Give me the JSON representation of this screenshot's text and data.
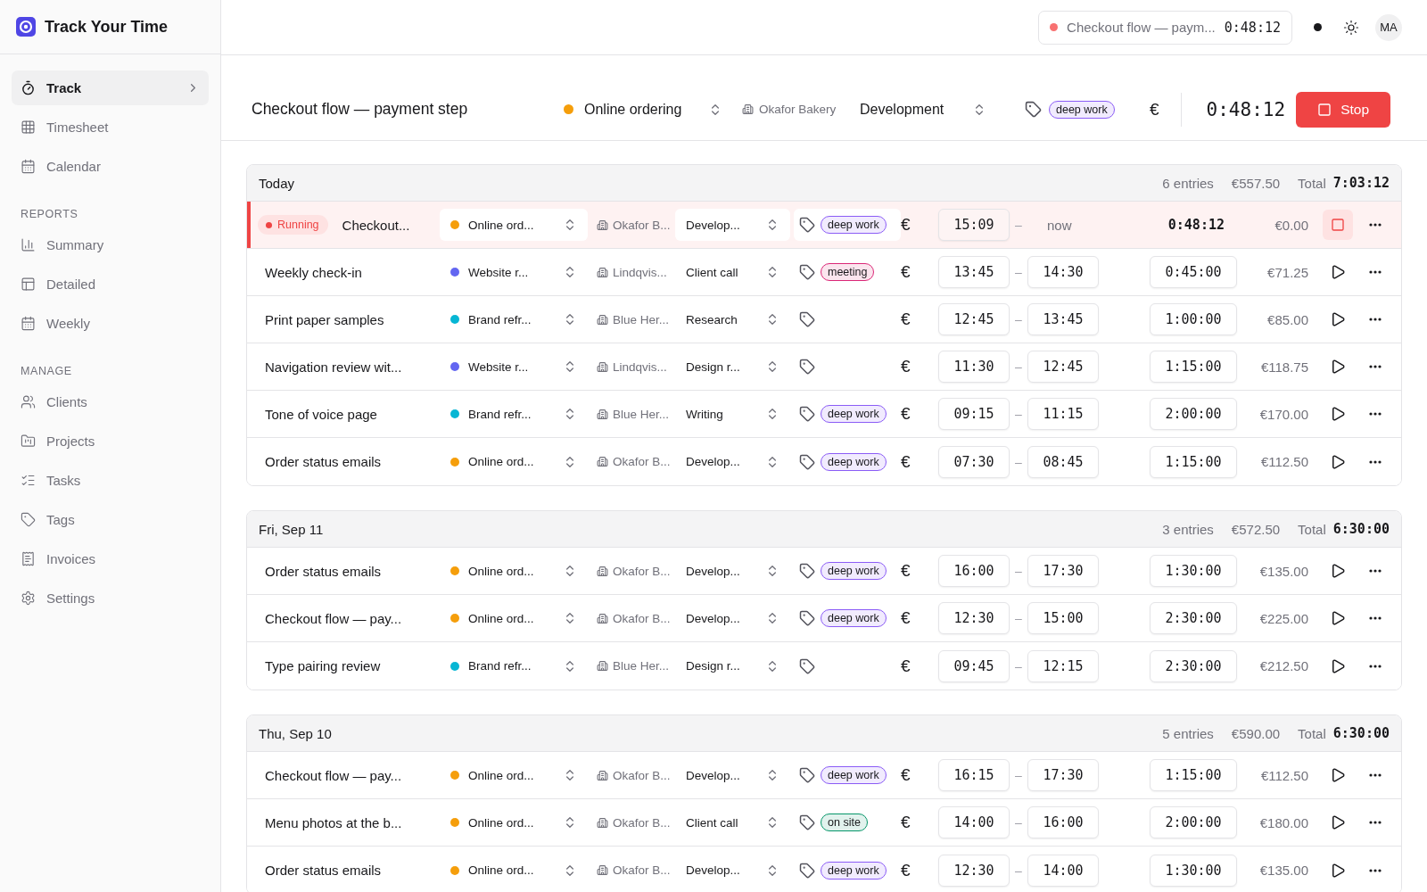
{
  "app": {
    "title": "Track Your Time"
  },
  "sidebar": {
    "sections": [
      {
        "items": [
          {
            "label": "Track",
            "selected": true
          },
          {
            "label": "Timesheet",
            "selected": false
          },
          {
            "label": "Calendar",
            "selected": false
          }
        ]
      },
      {
        "heading": "REPORTS",
        "items": [
          {
            "label": "Summary",
            "selected": false
          },
          {
            "label": "Detailed",
            "selected": false
          },
          {
            "label": "Weekly",
            "selected": false
          }
        ]
      },
      {
        "heading": "MANAGE",
        "items": [
          {
            "label": "Clients",
            "selected": false
          },
          {
            "label": "Projects",
            "selected": false
          },
          {
            "label": "Tasks",
            "selected": false
          },
          {
            "label": "Tags",
            "selected": false
          },
          {
            "label": "Invoices",
            "selected": false
          },
          {
            "label": "Settings",
            "selected": false
          }
        ]
      }
    ]
  },
  "topbar": {
    "current": {
      "description": "Checkout flow — paym...",
      "time": "0:48:12",
      "color": "#f87171"
    },
    "avatar": "MA"
  },
  "timer": {
    "description": "Checkout flow — payment step",
    "project": {
      "name": "Online ordering",
      "color": "#f59e0b"
    },
    "client": "Okafor Bakery",
    "task": "Development",
    "tags": [
      {
        "label": "deep work",
        "color": "#8b5cf6"
      }
    ],
    "currency": "€",
    "time": "0:48:12",
    "button": "Stop"
  },
  "groups": [
    {
      "label": "Today",
      "entries": "6 entries",
      "amount": "€557.50",
      "total_label": "Total",
      "total": "7:03:12",
      "rows": [
        {
          "kind": "running",
          "badge": "Running",
          "description": "Checkout...",
          "project": {
            "name": "Online ord...",
            "color": "#f59e0b"
          },
          "client": "Okafor B...",
          "task": "Develop...",
          "tags": [
            {
              "label": "deep work",
              "color": "#8b5cf6"
            }
          ],
          "currency": "€",
          "start": "15:09",
          "separator": "–",
          "end": "now",
          "duration": "0:48:12",
          "amount": "€0.00"
        },
        {
          "kind": "stopped",
          "description": "Weekly check-in",
          "project": {
            "name": "Website r...",
            "color": "#6366f1"
          },
          "client": "Lindqvis...",
          "task": "Client call",
          "tags": [
            {
              "label": "meeting",
              "color": "#db2777"
            }
          ],
          "currency": "€",
          "start": "13:45",
          "separator": "–",
          "end": "14:30",
          "duration": "0:45:00",
          "amount": "€71.25"
        },
        {
          "kind": "stopped",
          "description": "Print paper samples",
          "project": {
            "name": "Brand refr...",
            "color": "#06b6d4"
          },
          "client": "Blue Her...",
          "task": "Research",
          "tags": [],
          "currency": "€",
          "start": "12:45",
          "separator": "–",
          "end": "13:45",
          "duration": "1:00:00",
          "amount": "€85.00"
        },
        {
          "kind": "stopped",
          "description": "Navigation review wit...",
          "project": {
            "name": "Website r...",
            "color": "#6366f1"
          },
          "client": "Lindqvis...",
          "task": "Design r...",
          "tags": [],
          "currency": "€",
          "start": "11:30",
          "separator": "–",
          "end": "12:45",
          "duration": "1:15:00",
          "amount": "€118.75"
        },
        {
          "kind": "stopped",
          "description": "Tone of voice page",
          "project": {
            "name": "Brand refr...",
            "color": "#06b6d4"
          },
          "client": "Blue Her...",
          "task": "Writing",
          "tags": [
            {
              "label": "deep work",
              "color": "#8b5cf6"
            }
          ],
          "currency": "€",
          "start": "09:15",
          "separator": "–",
          "end": "11:15",
          "duration": "2:00:00",
          "amount": "€170.00"
        },
        {
          "kind": "stopped",
          "description": "Order status emails",
          "project": {
            "name": "Online ord...",
            "color": "#f59e0b"
          },
          "client": "Okafor B...",
          "task": "Develop...",
          "tags": [
            {
              "label": "deep work",
              "color": "#8b5cf6"
            }
          ],
          "currency": "€",
          "start": "07:30",
          "separator": "–",
          "end": "08:45",
          "duration": "1:15:00",
          "amount": "€112.50"
        }
      ]
    },
    {
      "label": "Fri, Sep 11",
      "entries": "3 entries",
      "amount": "€572.50",
      "total_label": "Total",
      "total": "6:30:00",
      "rows": [
        {
          "kind": "stopped",
          "description": "Order status emails",
          "project": {
            "name": "Online ord...",
            "color": "#f59e0b"
          },
          "client": "Okafor B...",
          "task": "Develop...",
          "tags": [
            {
              "label": "deep work",
              "color": "#8b5cf6"
            }
          ],
          "currency": "€",
          "start": "16:00",
          "separator": "–",
          "end": "17:30",
          "duration": "1:30:00",
          "amount": "€135.00"
        },
        {
          "kind": "stopped",
          "description": "Checkout flow — pay...",
          "project": {
            "name": "Online ord...",
            "color": "#f59e0b"
          },
          "client": "Okafor B...",
          "task": "Develop...",
          "tags": [
            {
              "label": "deep work",
              "color": "#8b5cf6"
            }
          ],
          "currency": "€",
          "start": "12:30",
          "separator": "–",
          "end": "15:00",
          "duration": "2:30:00",
          "amount": "€225.00"
        },
        {
          "kind": "stopped",
          "description": "Type pairing review",
          "project": {
            "name": "Brand refr...",
            "color": "#06b6d4"
          },
          "client": "Blue Her...",
          "task": "Design r...",
          "tags": [],
          "currency": "€",
          "start": "09:45",
          "separator": "–",
          "end": "12:15",
          "duration": "2:30:00",
          "amount": "€212.50"
        }
      ]
    },
    {
      "label": "Thu, Sep 10",
      "entries": "5 entries",
      "amount": "€590.00",
      "total_label": "Total",
      "total": "6:30:00",
      "rows": [
        {
          "kind": "stopped",
          "description": "Checkout flow — pay...",
          "project": {
            "name": "Online ord...",
            "color": "#f59e0b"
          },
          "client": "Okafor B...",
          "task": "Develop...",
          "tags": [
            {
              "label": "deep work",
              "color": "#8b5cf6"
            }
          ],
          "currency": "€",
          "start": "16:15",
          "separator": "–",
          "end": "17:30",
          "duration": "1:15:00",
          "amount": "€112.50"
        },
        {
          "kind": "stopped",
          "description": "Menu photos at the b...",
          "project": {
            "name": "Online ord...",
            "color": "#f59e0b"
          },
          "client": "Okafor B...",
          "task": "Client call",
          "tags": [
            {
              "label": "on site",
              "color": "#059669"
            }
          ],
          "currency": "€",
          "start": "14:00",
          "separator": "–",
          "end": "16:00",
          "duration": "2:00:00",
          "amount": "€180.00"
        },
        {
          "kind": "stopped",
          "description": "Order status emails",
          "project": {
            "name": "Online ord...",
            "color": "#f59e0b"
          },
          "client": "Okafor B...",
          "task": "Develop...",
          "tags": [
            {
              "label": "deep work",
              "color": "#8b5cf6"
            }
          ],
          "currency": "€",
          "start": "12:30",
          "separator": "–",
          "end": "14:00",
          "duration": "1:30:00",
          "amount": "€135.00"
        }
      ]
    }
  ]
}
